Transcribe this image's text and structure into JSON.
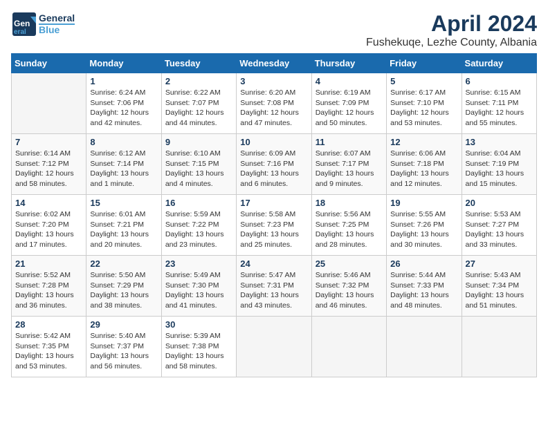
{
  "header": {
    "logo_line1": "General",
    "logo_line2": "Blue",
    "month": "April 2024",
    "location": "Fushekuqe, Lezhe County, Albania"
  },
  "weekdays": [
    "Sunday",
    "Monday",
    "Tuesday",
    "Wednesday",
    "Thursday",
    "Friday",
    "Saturday"
  ],
  "weeks": [
    [
      {
        "day": "",
        "info": ""
      },
      {
        "day": "1",
        "info": "Sunrise: 6:24 AM\nSunset: 7:06 PM\nDaylight: 12 hours\nand 42 minutes."
      },
      {
        "day": "2",
        "info": "Sunrise: 6:22 AM\nSunset: 7:07 PM\nDaylight: 12 hours\nand 44 minutes."
      },
      {
        "day": "3",
        "info": "Sunrise: 6:20 AM\nSunset: 7:08 PM\nDaylight: 12 hours\nand 47 minutes."
      },
      {
        "day": "4",
        "info": "Sunrise: 6:19 AM\nSunset: 7:09 PM\nDaylight: 12 hours\nand 50 minutes."
      },
      {
        "day": "5",
        "info": "Sunrise: 6:17 AM\nSunset: 7:10 PM\nDaylight: 12 hours\nand 53 minutes."
      },
      {
        "day": "6",
        "info": "Sunrise: 6:15 AM\nSunset: 7:11 PM\nDaylight: 12 hours\nand 55 minutes."
      }
    ],
    [
      {
        "day": "7",
        "info": "Sunrise: 6:14 AM\nSunset: 7:12 PM\nDaylight: 12 hours\nand 58 minutes."
      },
      {
        "day": "8",
        "info": "Sunrise: 6:12 AM\nSunset: 7:14 PM\nDaylight: 13 hours\nand 1 minute."
      },
      {
        "day": "9",
        "info": "Sunrise: 6:10 AM\nSunset: 7:15 PM\nDaylight: 13 hours\nand 4 minutes."
      },
      {
        "day": "10",
        "info": "Sunrise: 6:09 AM\nSunset: 7:16 PM\nDaylight: 13 hours\nand 6 minutes."
      },
      {
        "day": "11",
        "info": "Sunrise: 6:07 AM\nSunset: 7:17 PM\nDaylight: 13 hours\nand 9 minutes."
      },
      {
        "day": "12",
        "info": "Sunrise: 6:06 AM\nSunset: 7:18 PM\nDaylight: 13 hours\nand 12 minutes."
      },
      {
        "day": "13",
        "info": "Sunrise: 6:04 AM\nSunset: 7:19 PM\nDaylight: 13 hours\nand 15 minutes."
      }
    ],
    [
      {
        "day": "14",
        "info": "Sunrise: 6:02 AM\nSunset: 7:20 PM\nDaylight: 13 hours\nand 17 minutes."
      },
      {
        "day": "15",
        "info": "Sunrise: 6:01 AM\nSunset: 7:21 PM\nDaylight: 13 hours\nand 20 minutes."
      },
      {
        "day": "16",
        "info": "Sunrise: 5:59 AM\nSunset: 7:22 PM\nDaylight: 13 hours\nand 23 minutes."
      },
      {
        "day": "17",
        "info": "Sunrise: 5:58 AM\nSunset: 7:23 PM\nDaylight: 13 hours\nand 25 minutes."
      },
      {
        "day": "18",
        "info": "Sunrise: 5:56 AM\nSunset: 7:25 PM\nDaylight: 13 hours\nand 28 minutes."
      },
      {
        "day": "19",
        "info": "Sunrise: 5:55 AM\nSunset: 7:26 PM\nDaylight: 13 hours\nand 30 minutes."
      },
      {
        "day": "20",
        "info": "Sunrise: 5:53 AM\nSunset: 7:27 PM\nDaylight: 13 hours\nand 33 minutes."
      }
    ],
    [
      {
        "day": "21",
        "info": "Sunrise: 5:52 AM\nSunset: 7:28 PM\nDaylight: 13 hours\nand 36 minutes."
      },
      {
        "day": "22",
        "info": "Sunrise: 5:50 AM\nSunset: 7:29 PM\nDaylight: 13 hours\nand 38 minutes."
      },
      {
        "day": "23",
        "info": "Sunrise: 5:49 AM\nSunset: 7:30 PM\nDaylight: 13 hours\nand 41 minutes."
      },
      {
        "day": "24",
        "info": "Sunrise: 5:47 AM\nSunset: 7:31 PM\nDaylight: 13 hours\nand 43 minutes."
      },
      {
        "day": "25",
        "info": "Sunrise: 5:46 AM\nSunset: 7:32 PM\nDaylight: 13 hours\nand 46 minutes."
      },
      {
        "day": "26",
        "info": "Sunrise: 5:44 AM\nSunset: 7:33 PM\nDaylight: 13 hours\nand 48 minutes."
      },
      {
        "day": "27",
        "info": "Sunrise: 5:43 AM\nSunset: 7:34 PM\nDaylight: 13 hours\nand 51 minutes."
      }
    ],
    [
      {
        "day": "28",
        "info": "Sunrise: 5:42 AM\nSunset: 7:35 PM\nDaylight: 13 hours\nand 53 minutes."
      },
      {
        "day": "29",
        "info": "Sunrise: 5:40 AM\nSunset: 7:37 PM\nDaylight: 13 hours\nand 56 minutes."
      },
      {
        "day": "30",
        "info": "Sunrise: 5:39 AM\nSunset: 7:38 PM\nDaylight: 13 hours\nand 58 minutes."
      },
      {
        "day": "",
        "info": ""
      },
      {
        "day": "",
        "info": ""
      },
      {
        "day": "",
        "info": ""
      },
      {
        "day": "",
        "info": ""
      }
    ]
  ]
}
